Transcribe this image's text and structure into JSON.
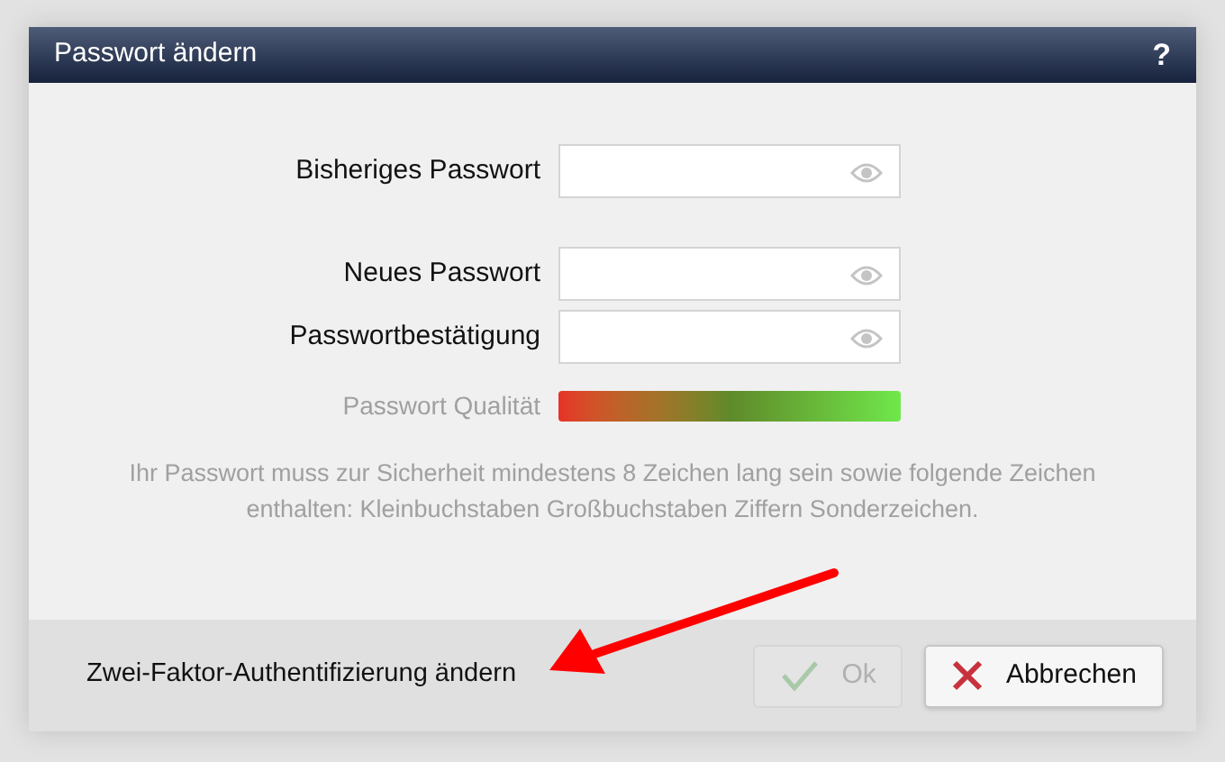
{
  "dialog": {
    "title": "Passwort ändern",
    "help": "?"
  },
  "field_groups": [
    [
      {
        "label": "Bisheriges Passwort"
      }
    ],
    [
      {
        "label": "Neues Passwort"
      },
      {
        "label": "Passwortbestätigung"
      }
    ]
  ],
  "quality": {
    "label": "Passwort Qualität"
  },
  "hint": "Ihr Passwort muss zur Sicherheit mindestens 8 Zeichen lang sein sowie folgende Zeichen enthalten: Kleinbuchstaben Großbuchstaben Ziffern Sonderzeichen.",
  "footer": {
    "link": "Zwei-Faktor-Authentifizierung ändern",
    "buttons": [
      {
        "label": "Ok",
        "kind": "ok",
        "disabled": true
      },
      {
        "label": "Abbrechen",
        "kind": "cancel",
        "disabled": false
      }
    ]
  }
}
